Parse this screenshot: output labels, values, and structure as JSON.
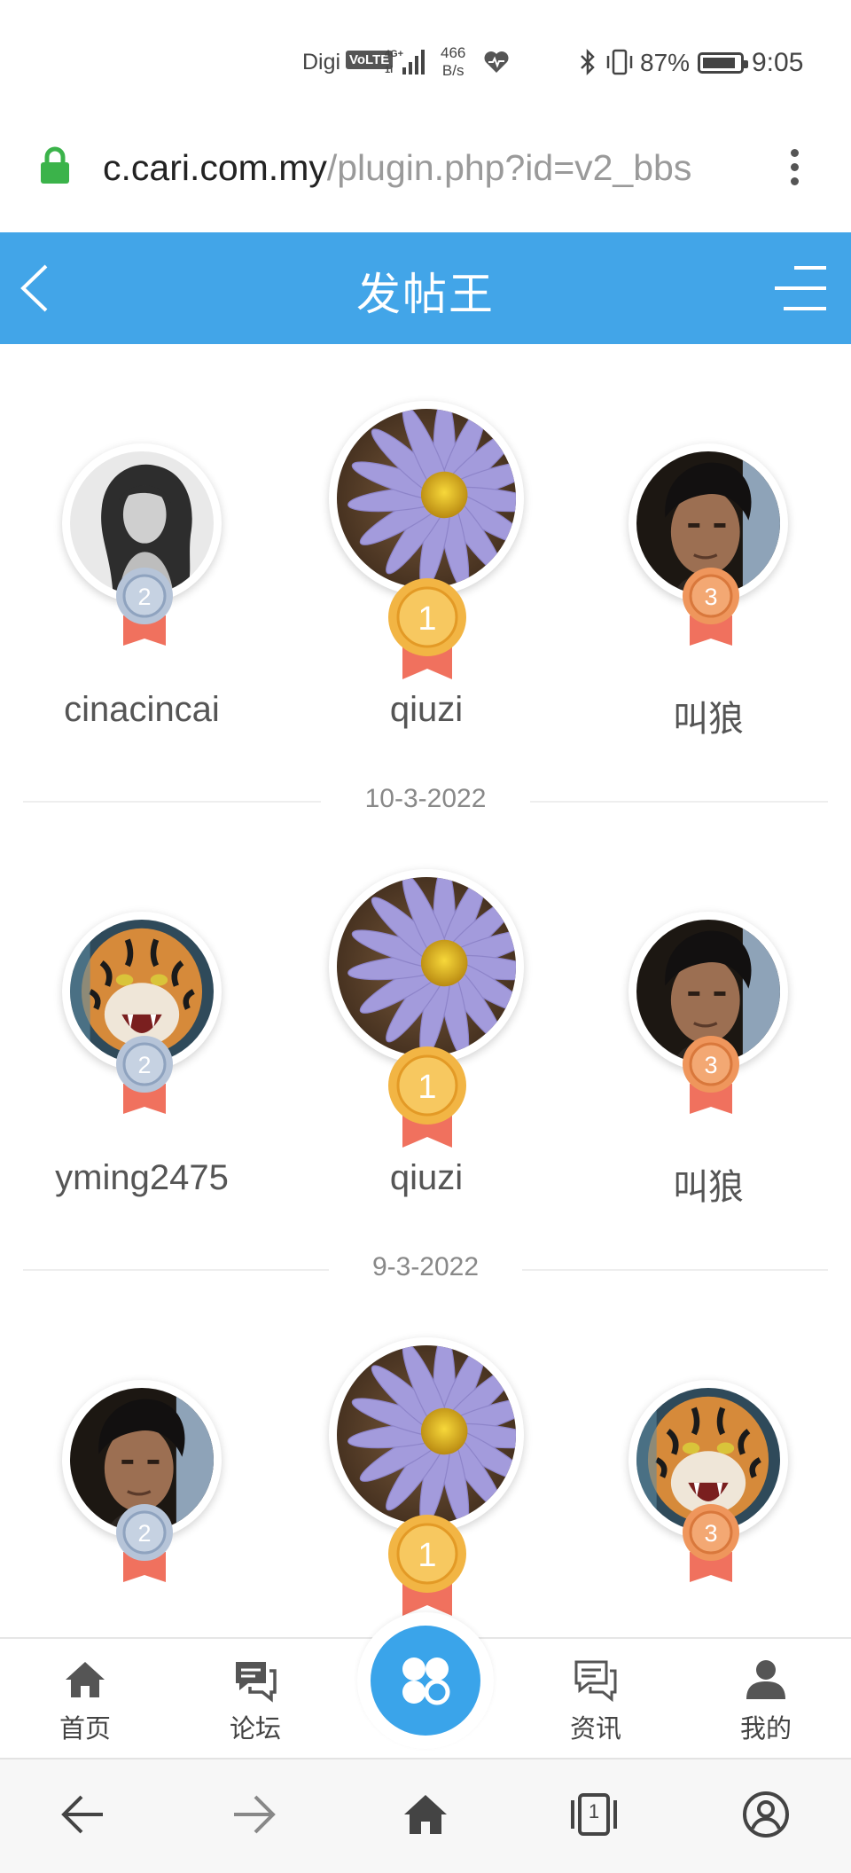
{
  "status_bar": {
    "carrier": "Digi",
    "volte": "VoLTE",
    "network_speed_value": "466",
    "network_speed_unit": "B/s",
    "battery_percent": "87%",
    "time": "9:05"
  },
  "browser": {
    "url_host": "c.cari.com.my",
    "url_path": "/plugin.php?id=v2_bbs"
  },
  "header": {
    "title": "发帖王"
  },
  "rankings": [
    {
      "first": {
        "name": "qiuzi",
        "rank": "1",
        "avatar": "flower"
      },
      "second": {
        "name": "cinacincai",
        "rank": "2",
        "avatar": "woman"
      },
      "third": {
        "name": "叫狼",
        "rank": "3",
        "avatar": "man"
      }
    },
    {
      "date": "10-3-2022",
      "first": {
        "name": "qiuzi",
        "rank": "1",
        "avatar": "flower"
      },
      "second": {
        "name": "yming2475",
        "rank": "2",
        "avatar": "tiger"
      },
      "third": {
        "name": "叫狼",
        "rank": "3",
        "avatar": "man"
      }
    },
    {
      "date": "9-3-2022",
      "first": {
        "name": "",
        "rank": "1",
        "avatar": "flower"
      },
      "second": {
        "name": "",
        "rank": "2",
        "avatar": "man"
      },
      "third": {
        "name": "",
        "rank": "3",
        "avatar": "tiger"
      }
    }
  ],
  "bottom_nav": {
    "home": "首页",
    "forum": "论坛",
    "news": "资讯",
    "mine": "我的"
  },
  "browser_bar": {
    "tab_count": "1"
  },
  "colors": {
    "accent": "#42a5e8",
    "gold": "#f2b544",
    "silver": "#b6c4d8",
    "bronze": "#ef965c",
    "ribbon": "#f0715e"
  }
}
